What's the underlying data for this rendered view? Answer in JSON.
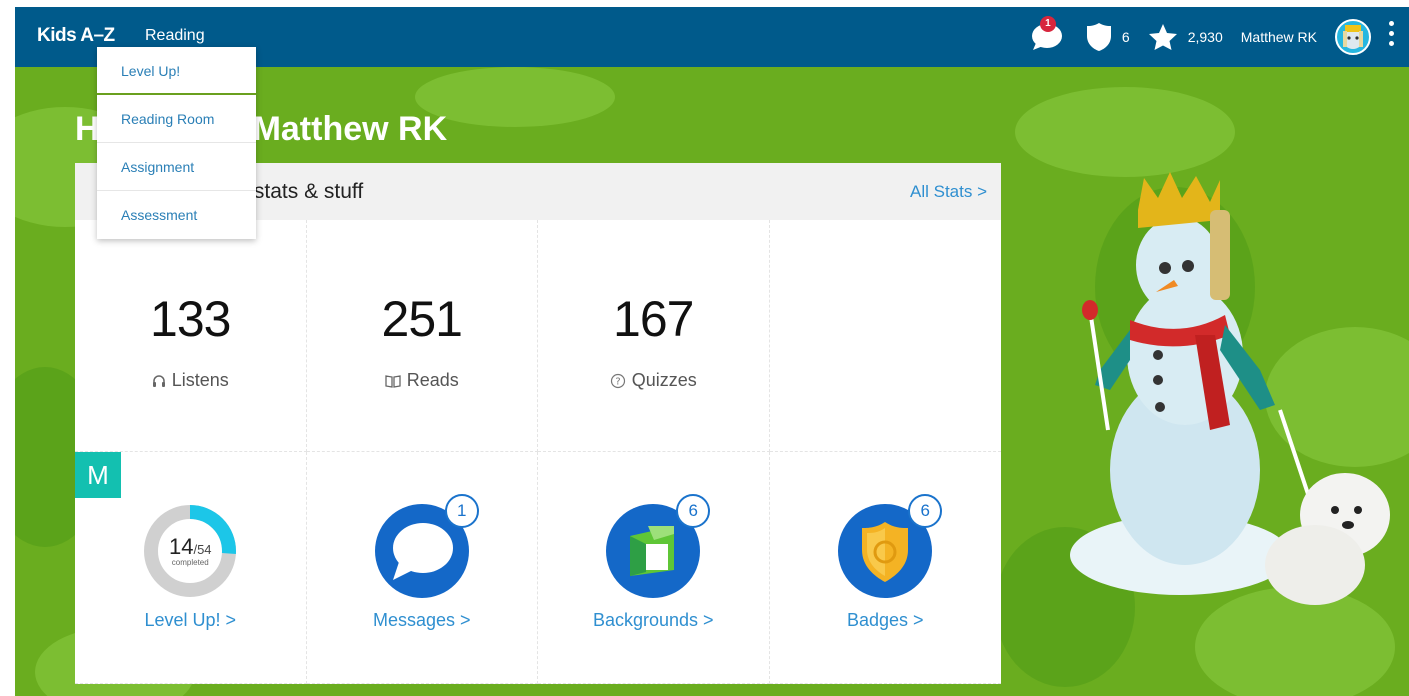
{
  "header": {
    "brand": "Kids A–Z",
    "nav_reading": "Reading",
    "message_badge": "1",
    "shield_count": "6",
    "star_count": "2,930",
    "user_name": "Matthew RK"
  },
  "dropdown": {
    "items": [
      "Level Up!",
      "Reading Room",
      "Assignment",
      "Assessment"
    ]
  },
  "greeting_visible": "Matthew RK",
  "stats": {
    "title_visible": "uper stats & stuff",
    "all_stats": "All Stats >",
    "listens": {
      "value": "133",
      "label": "Listens"
    },
    "reads": {
      "value": "251",
      "label": "Reads"
    },
    "quizzes": {
      "value": "167",
      "label": "Quizzes"
    }
  },
  "tiles": {
    "m_tag": "M",
    "levelup": {
      "done": "14",
      "total": "/54",
      "caption": "completed",
      "fraction": 0.26,
      "link": "Level Up! >"
    },
    "messages": {
      "badge": "1",
      "link": "Messages >"
    },
    "backgrounds": {
      "badge": "6",
      "link": "Backgrounds >"
    },
    "badges": {
      "badge": "6",
      "link": "Badges >"
    }
  },
  "colors": {
    "header": "#005a8b",
    "background": "#6aad1f",
    "link": "#2f8fd0",
    "accent_blue": "#1a73cc",
    "progress": "#1cc6e8",
    "m_tag": "#13c0b0"
  },
  "icons": [
    "message-bubble-icon",
    "shield-icon",
    "star-icon",
    "kebab-menu-icon",
    "headphones-icon",
    "book-icon",
    "question-icon"
  ]
}
